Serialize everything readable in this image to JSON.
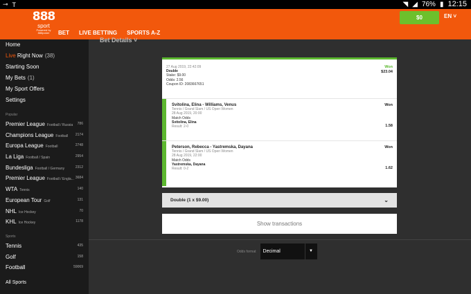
{
  "statusbar": {
    "left_icons": [
      "key-icon",
      "t-icon"
    ],
    "battery": "76%",
    "time": "12:15"
  },
  "header": {
    "logo_main": "888",
    "logo_sub": "sport",
    "logo_powered": "Powered by 888poker",
    "nav": [
      "BET",
      "LIVE BETTING",
      "SPORTS A-Z"
    ],
    "balance": "$0",
    "lang": "EN ˅"
  },
  "sidebar": {
    "main": [
      {
        "label": "Home"
      },
      {
        "live": "Live",
        "label": "Right Now",
        "count": "(38)"
      },
      {
        "label": "Starting Soon"
      },
      {
        "label": "My Bets",
        "count": "(1)"
      },
      {
        "label": "My Sport Offers"
      },
      {
        "label": "Settings"
      }
    ],
    "popular_title": "Popular",
    "popular": [
      {
        "name": "Premier League",
        "sub": "Football / Russia",
        "num": "786"
      },
      {
        "name": "Champions League",
        "sub": "Football",
        "num": "2174"
      },
      {
        "name": "Europa League",
        "sub": "Football",
        "num": "2748"
      },
      {
        "name": "La Liga",
        "sub": "Football / Spain",
        "num": "2954"
      },
      {
        "name": "Bundesliga",
        "sub": "Football / Germany",
        "num": "2312"
      },
      {
        "name": "Premier League",
        "sub": "Football / Engla...",
        "num": "3684"
      },
      {
        "name": "WTA",
        "sub": "Tennis",
        "num": "140"
      },
      {
        "name": "European Tour",
        "sub": "Golf",
        "num": "131"
      },
      {
        "name": "NHL",
        "sub": "Ice Hockey",
        "num": "70"
      },
      {
        "name": "KHL",
        "sub": "Ice Hockey",
        "num": "1178"
      }
    ],
    "sports_title": "Sports",
    "sports": [
      {
        "name": "Tennis",
        "num": "435"
      },
      {
        "name": "Golf",
        "num": "158"
      },
      {
        "name": "Football",
        "num": "59069"
      }
    ],
    "all_sports": "All Sports"
  },
  "main": {
    "title": "Bet Details ˅",
    "summary": {
      "date": "27 Aug 2019, 22:42:09",
      "type": "Double",
      "status": "Won",
      "payout": "$23.04",
      "stake": "Stake: $9.00",
      "odds": "Odds: 2.56",
      "coupon": "Coupon ID: 2083667651"
    },
    "selections": [
      {
        "event": "Svitolina, Elina - Williams, Venus",
        "status": "Won",
        "comp": "Tennis / Grand Slam / US Open Women",
        "date": "28 Aug 2019, 20:00",
        "market": "Match Odds",
        "pick": "Svitolina, Elina",
        "odds": "1.58",
        "result": "Result: 2-0"
      },
      {
        "event": "Peterson, Rebecca - Yastremska, Dayana",
        "status": "Won",
        "comp": "Tennis / Grand Slam / US Open Women",
        "date": "28 Aug 2019, 22:00",
        "market": "Match Odds",
        "pick": "Yastremska, Dayana",
        "odds": "1.62",
        "result": "Result: 0-2"
      }
    ],
    "accordion": "Double (1 x $9.00)",
    "show_transactions": "Show transactions",
    "odds_format_label": "Odds format",
    "odds_format_value": "Decimal"
  }
}
